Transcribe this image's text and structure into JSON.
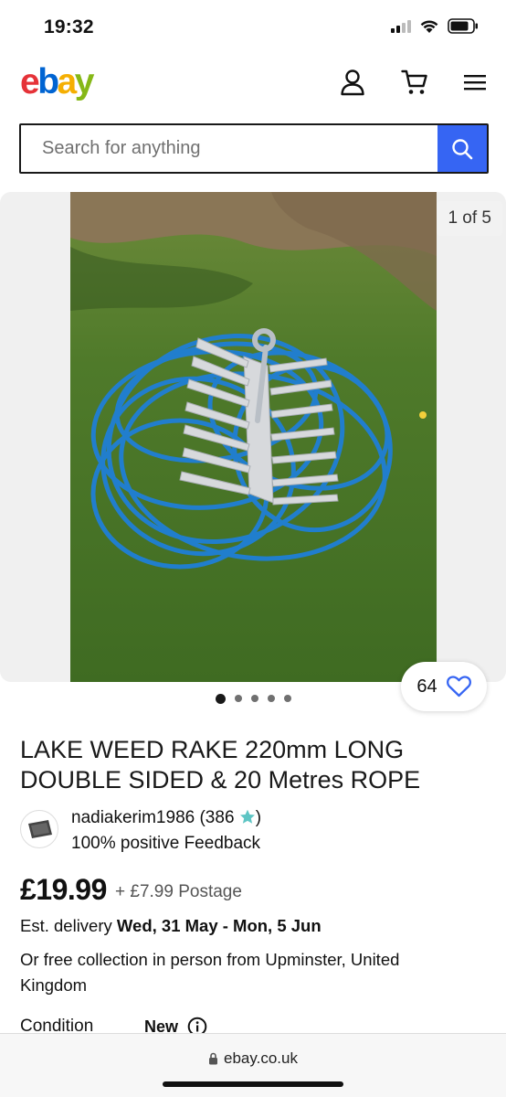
{
  "status": {
    "time": "19:32"
  },
  "header": {
    "logo": [
      "e",
      "b",
      "a",
      "y"
    ]
  },
  "search": {
    "placeholder": "Search for anything"
  },
  "gallery": {
    "counter": "1 of 5",
    "watchers": "64",
    "dots_total": 5,
    "active_index": 0
  },
  "listing": {
    "title": "LAKE WEED RAKE 220mm LONG DOUBLE SIDED & 20 Metres ROPE",
    "seller_name": "nadiakerim1986",
    "seller_score": "(386",
    "seller_score_close": ")",
    "seller_feedback": "100% positive Feedback",
    "price": "£19.99",
    "postage": "+ £7.99 Postage",
    "delivery_label": "Est. delivery",
    "delivery_dates": "Wed, 31 May - Mon, 5 Jun",
    "collection": "Or free collection in person from Upminster, United Kingdom",
    "condition_label": "Condition",
    "condition_value": "New"
  },
  "browser": {
    "url": "ebay.co.uk"
  },
  "colors": {
    "accent": "#3665f3",
    "star": "#5ec5c4"
  }
}
